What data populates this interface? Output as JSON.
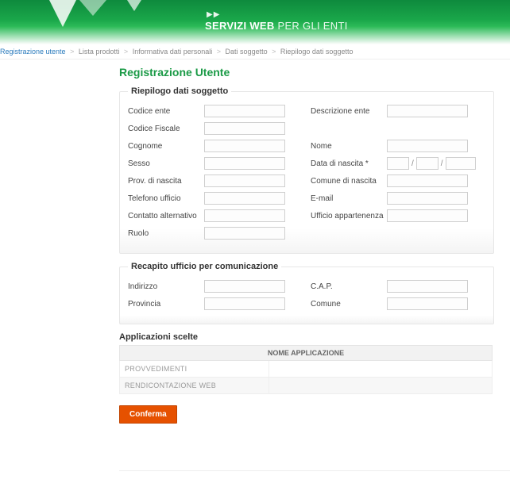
{
  "header": {
    "brand_bold": "SERVIZI WEB",
    "brand_light": " PER GLI ENTI",
    "arrows": "▶▶"
  },
  "breadcrumb": {
    "items": [
      {
        "label": "Registrazione utente",
        "link": true
      },
      {
        "label": "Lista prodotti",
        "link": false
      },
      {
        "label": "Informativa dati personali",
        "link": false
      },
      {
        "label": "Dati soggetto",
        "link": false
      },
      {
        "label": "Riepilogo dati soggetto",
        "link": false
      }
    ],
    "sep": ">"
  },
  "page_title": "Registrazione Utente",
  "sections": {
    "riepilogo": {
      "legend": "Riepilogo dati soggetto",
      "fields": {
        "codice_ente": {
          "label": "Codice ente",
          "value": " "
        },
        "descrizione_ente": {
          "label": "Descrizione ente",
          "value": " "
        },
        "codice_fiscale": {
          "label": "Codice Fiscale",
          "value": " "
        },
        "cognome": {
          "label": "Cognome",
          "value": " "
        },
        "nome": {
          "label": "Nome",
          "value": " "
        },
        "sesso": {
          "label": "Sesso",
          "value": " "
        },
        "data_nascita": {
          "label": "Data di nascita *",
          "gg": " ",
          "mm": " ",
          "aaaa": " ",
          "slash": "/"
        },
        "prov_nascita": {
          "label": "Prov. di nascita",
          "value": " "
        },
        "comune_nascita": {
          "label": "Comune di nascita",
          "value": " "
        },
        "telefono_ufficio": {
          "label": "Telefono ufficio",
          "value": " "
        },
        "email": {
          "label": "E-mail",
          "value": " "
        },
        "contatto_alt": {
          "label": "Contatto alternativo",
          "value": " "
        },
        "ufficio_app": {
          "label": "Ufficio appartenenza",
          "value": " "
        },
        "ruolo": {
          "label": "Ruolo",
          "value": " "
        }
      }
    },
    "recapito": {
      "legend": "Recapito ufficio per comunicazione",
      "fields": {
        "indirizzo": {
          "label": "Indirizzo",
          "value": " "
        },
        "cap": {
          "label": "C.A.P.",
          "value": " "
        },
        "provincia": {
          "label": "Provincia",
          "value": " "
        },
        "comune": {
          "label": "Comune",
          "value": " "
        }
      }
    }
  },
  "applicazioni": {
    "title": "Applicazioni scelte",
    "header": "NOME APPLICAZIONE",
    "rows": [
      {
        "name": "PROVVEDIMENTI",
        "desc": " "
      },
      {
        "name": "RENDICONTAZIONE WEB",
        "desc": ""
      }
    ]
  },
  "actions": {
    "confirm": "Conferma"
  }
}
